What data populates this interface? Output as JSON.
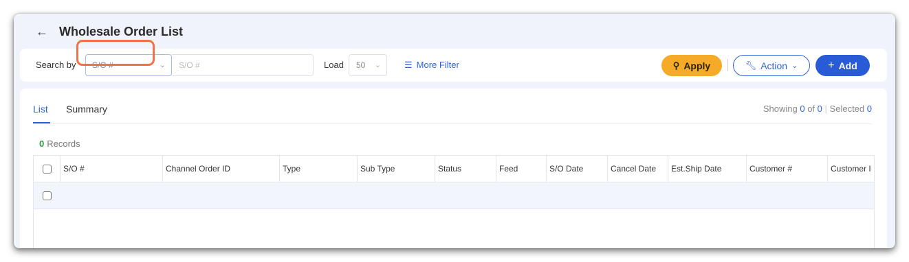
{
  "header": {
    "back_icon": "arrow-left-icon",
    "title": "Wholesale Order List"
  },
  "toolbar": {
    "search_by_label": "Search by",
    "search_field": {
      "value": "S/O #"
    },
    "search_input": {
      "placeholder": "S/O #"
    },
    "load_label": "Load",
    "load_value": "50",
    "more_filter_label": "More Filter",
    "apply_label": "Apply",
    "action_label": "Action",
    "add_label": "Add",
    "colors": {
      "apply": "#f5aa28",
      "primary": "#2a5bd7",
      "highlight": "#ef7148"
    }
  },
  "tabs": [
    {
      "label": "List",
      "active": true
    },
    {
      "label": "Summary",
      "active": false
    }
  ],
  "status": {
    "showing_label": "Showing",
    "showing_count": "0",
    "of_label": "of",
    "total_count": "0",
    "selected_label": "Selected",
    "selected_count": "0"
  },
  "records": {
    "count": "0",
    "label": "Records"
  },
  "table": {
    "columns": [
      "S/O #",
      "Channel Order ID",
      "Type",
      "Sub Type",
      "Status",
      "Feed",
      "S/O Date",
      "Cancel Date",
      "Est.Ship Date",
      "Customer #",
      "Customer I"
    ]
  }
}
